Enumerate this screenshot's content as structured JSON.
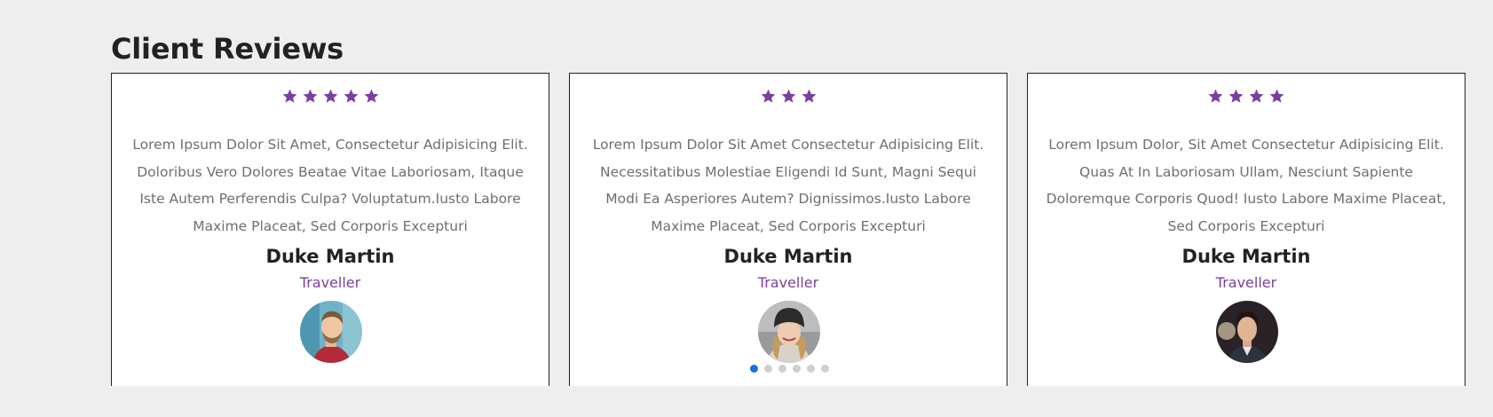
{
  "section": {
    "title": "Client Reviews"
  },
  "accent_color": "#7b3fa0",
  "reviews": [
    {
      "rating": 5,
      "text": "Lorem Ipsum Dolor Sit Amet, Consectetur Adipisicing Elit. Doloribus Vero Dolores Beatae Vitae Laboriosam, Itaque Iste Autem Perferendis Culpa? Voluptatum.Iusto Labore Maxime Placeat, Sed Corporis Excepturi",
      "name": "Duke Martin",
      "role": "Traveller",
      "avatar": "man-beard-avatar"
    },
    {
      "rating": 3,
      "text": "Lorem Ipsum Dolor Sit Amet Consectetur Adipisicing Elit. Necessitatibus Molestiae Eligendi Id Sunt, Magni Sequi Modi Ea Asperiores Autem? Dignissimos.Iusto Labore Maxime Placeat, Sed Corporis Excepturi",
      "name": "Duke Martin",
      "role": "Traveller",
      "avatar": "woman-beanie-avatar"
    },
    {
      "rating": 4,
      "text": "Lorem Ipsum Dolor, Sit Amet Consectetur Adipisicing Elit. Quas At In Laboriosam Ullam, Nesciunt Sapiente Doloremque Corporis Quod! Iusto Labore Maxime Placeat, Sed Corporis Excepturi",
      "name": "Duke Martin",
      "role": "Traveller",
      "avatar": "man-suit-avatar"
    }
  ],
  "pagination": {
    "count": 6,
    "active_index": 0,
    "active_color": "#1a73d9",
    "inactive_color": "#cfcfcf"
  }
}
